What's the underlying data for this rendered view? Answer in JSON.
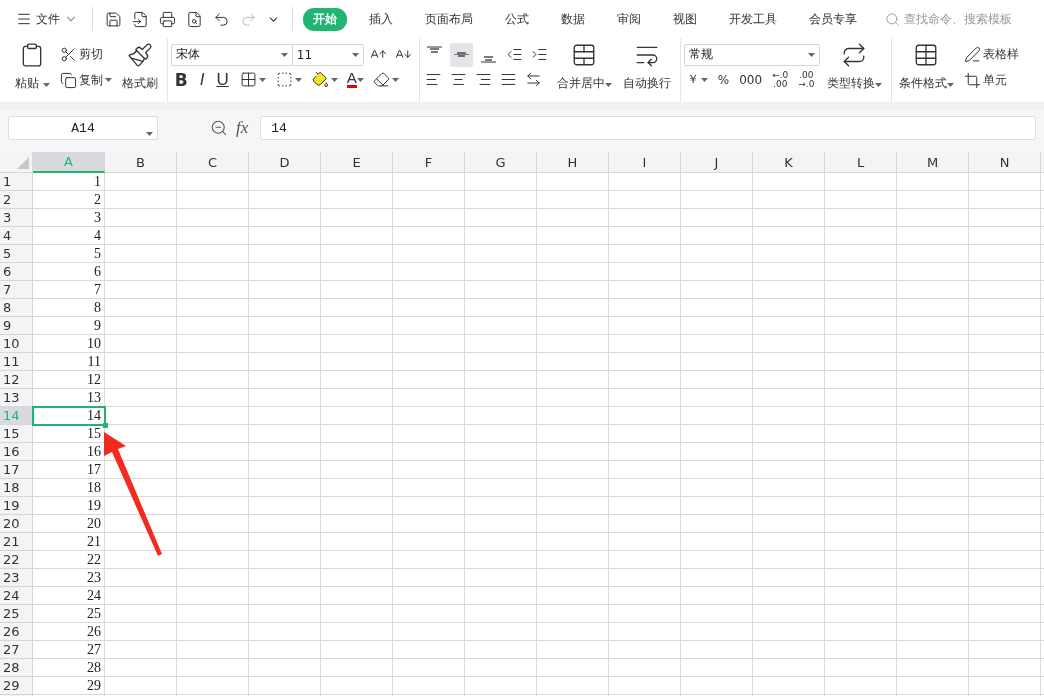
{
  "menu": {
    "file": "文件"
  },
  "tabs": [
    {
      "label": "开始",
      "selected": true
    },
    {
      "label": "插入",
      "selected": false
    },
    {
      "label": "页面布局",
      "selected": false
    },
    {
      "label": "公式",
      "selected": false
    },
    {
      "label": "数据",
      "selected": false
    },
    {
      "label": "审阅",
      "selected": false
    },
    {
      "label": "视图",
      "selected": false
    },
    {
      "label": "开发工具",
      "selected": false
    },
    {
      "label": "会员专享",
      "selected": false
    }
  ],
  "search": {
    "placeholder": "查找命令、搜索模板"
  },
  "ribbon": {
    "clipboard": {
      "paste": "粘贴",
      "cut": "剪切",
      "copy": "复制",
      "format_painter": "格式刷"
    },
    "font": {
      "name": "宋体",
      "size": "11",
      "bold": "B",
      "italic": "I",
      "underline": "U",
      "font_color": "A"
    },
    "alignment": {
      "vertical": [
        {
          "selected": false
        },
        {
          "selected": true
        },
        {
          "selected": false
        }
      ],
      "merge": "合并居中",
      "wrap": "自动换行"
    },
    "number": {
      "format": "常规",
      "currency": "￥",
      "percent": "%",
      "thousands": "000",
      "increase_decimal": [
        "←.0",
        ".00"
      ],
      "decrease_decimal": [
        ".00",
        "→.0"
      ],
      "convert": "类型转换"
    },
    "styles": {
      "conditional": "条件格式",
      "table_style": "表格样",
      "cell_style": "单元"
    }
  },
  "formula_bar": {
    "name_box": "A14",
    "fx": "fx",
    "value": "14"
  },
  "sheet": {
    "columns": [
      {
        "label": "A",
        "selected": true
      },
      {
        "label": "B",
        "selected": false
      },
      {
        "label": "C",
        "selected": false
      },
      {
        "label": "D",
        "selected": false
      },
      {
        "label": "E",
        "selected": false
      },
      {
        "label": "F",
        "selected": false
      },
      {
        "label": "G",
        "selected": false
      },
      {
        "label": "H",
        "selected": false
      },
      {
        "label": "I",
        "selected": false
      },
      {
        "label": "J",
        "selected": false
      },
      {
        "label": "K",
        "selected": false
      },
      {
        "label": "L",
        "selected": false
      },
      {
        "label": "M",
        "selected": false
      },
      {
        "label": "N",
        "selected": false
      }
    ],
    "rows": [
      {
        "label": "1",
        "value": "1",
        "selected": false
      },
      {
        "label": "2",
        "value": "2",
        "selected": false
      },
      {
        "label": "3",
        "value": "3",
        "selected": false
      },
      {
        "label": "4",
        "value": "4",
        "selected": false
      },
      {
        "label": "5",
        "value": "5",
        "selected": false
      },
      {
        "label": "6",
        "value": "6",
        "selected": false
      },
      {
        "label": "7",
        "value": "7",
        "selected": false
      },
      {
        "label": "8",
        "value": "8",
        "selected": false
      },
      {
        "label": "9",
        "value": "9",
        "selected": false
      },
      {
        "label": "10",
        "value": "10",
        "selected": false
      },
      {
        "label": "11",
        "value": "11",
        "selected": false
      },
      {
        "label": "12",
        "value": "12",
        "selected": false
      },
      {
        "label": "13",
        "value": "13",
        "selected": false
      },
      {
        "label": "14",
        "value": "14",
        "selected": true
      },
      {
        "label": "15",
        "value": "15",
        "selected": false
      },
      {
        "label": "16",
        "value": "16",
        "selected": false
      },
      {
        "label": "17",
        "value": "17",
        "selected": false
      },
      {
        "label": "18",
        "value": "18",
        "selected": false
      },
      {
        "label": "19",
        "value": "19",
        "selected": false
      },
      {
        "label": "20",
        "value": "20",
        "selected": false
      },
      {
        "label": "21",
        "value": "21",
        "selected": false
      },
      {
        "label": "22",
        "value": "22",
        "selected": false
      },
      {
        "label": "23",
        "value": "23",
        "selected": false
      },
      {
        "label": "24",
        "value": "24",
        "selected": false
      },
      {
        "label": "25",
        "value": "25",
        "selected": false
      },
      {
        "label": "26",
        "value": "26",
        "selected": false
      },
      {
        "label": "27",
        "value": "27",
        "selected": false
      },
      {
        "label": "28",
        "value": "28",
        "selected": false
      },
      {
        "label": "29",
        "value": "29",
        "selected": false
      }
    ]
  }
}
